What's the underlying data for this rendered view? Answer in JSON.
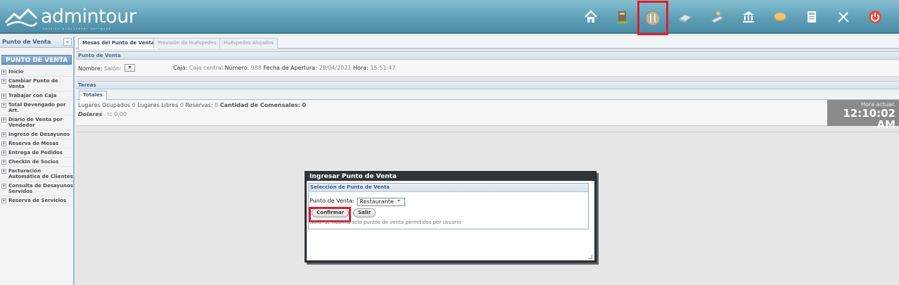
{
  "app": {
    "logo_text": "admintour",
    "logo_tagline": "TOURISM MANAGEMENT SOFTWARE"
  },
  "toolbar": {
    "icons": [
      "home-icon",
      "books-icon",
      "menu-pos-icon",
      "bed-icon",
      "guest-icon",
      "bank-icon",
      "money-icon",
      "calculator-icon",
      "tools-icon",
      "power-icon"
    ],
    "selected_index": 2
  },
  "sidebar": {
    "title": "Punto de Venta",
    "collapse_glyph": "«",
    "section": "PUNTO DE VENTA",
    "items": [
      "Inicio",
      "Cambiar Punto de Venta",
      "Trabajar con Caja",
      "Total Devengado por Art.",
      "Diario de Venta por Vendedor",
      "Ingreso de Desayunos",
      "Reserva de Mesas",
      "Entrega de Pedidos",
      "CheckIn de Socios",
      "Facturación Automática de Clientes",
      "Consulta de Desayunos Servidos",
      "Reserva de Servicios"
    ]
  },
  "tabs": [
    {
      "label": "Mesas del Punto de Venta",
      "active": true
    },
    {
      "label": "Previsión de Huéspedes",
      "active": false
    },
    {
      "label": "Huéspedes Alojados",
      "active": false
    }
  ],
  "pos_panel": {
    "title": "Punto de Venta",
    "nombre_label": "Nombre:",
    "nombre_value": "Salón:",
    "caja_label": "Caja:",
    "caja_value": "Caja central",
    "numero_label": "Número:",
    "numero_value": "988",
    "fecha_label": "Fecha de Apertura:",
    "fecha_value": "28/04/2021",
    "hora_label": "Hora:",
    "hora_value": "15:51:47"
  },
  "tasks_panel": {
    "title": "Tareas",
    "sub_tab": "Totales",
    "ocupados_label": "Lugares Ocupados",
    "ocupados_value": "0",
    "libres_label": "Lugares Libres",
    "libres_value": "0",
    "reservas_label": "Reservas:",
    "reservas_value": "0",
    "comensales_label": "Cantidad de Comensales:",
    "comensales_value": "0",
    "currency_label": "Dolares",
    "tc_label": "- TC",
    "tc_value": "0,00",
    "clock_label": "Hora actual:",
    "clock_value": "12:10:02 AM"
  },
  "dialog": {
    "title": "Ingresar Punto de Venta",
    "section_title": "Selección de Punto de Venta",
    "field_label": "Punto de Venta:",
    "field_value": "Restaurante",
    "confirm_label": "Confirmar",
    "exit_label": "Salir",
    "note": "Nota: Se habilita solo puntos de venta permitidos por usuario"
  },
  "colors": {
    "header": "#5fa0b8",
    "highlight": "#e01e2a",
    "dialog_frame": "#2f3437"
  }
}
